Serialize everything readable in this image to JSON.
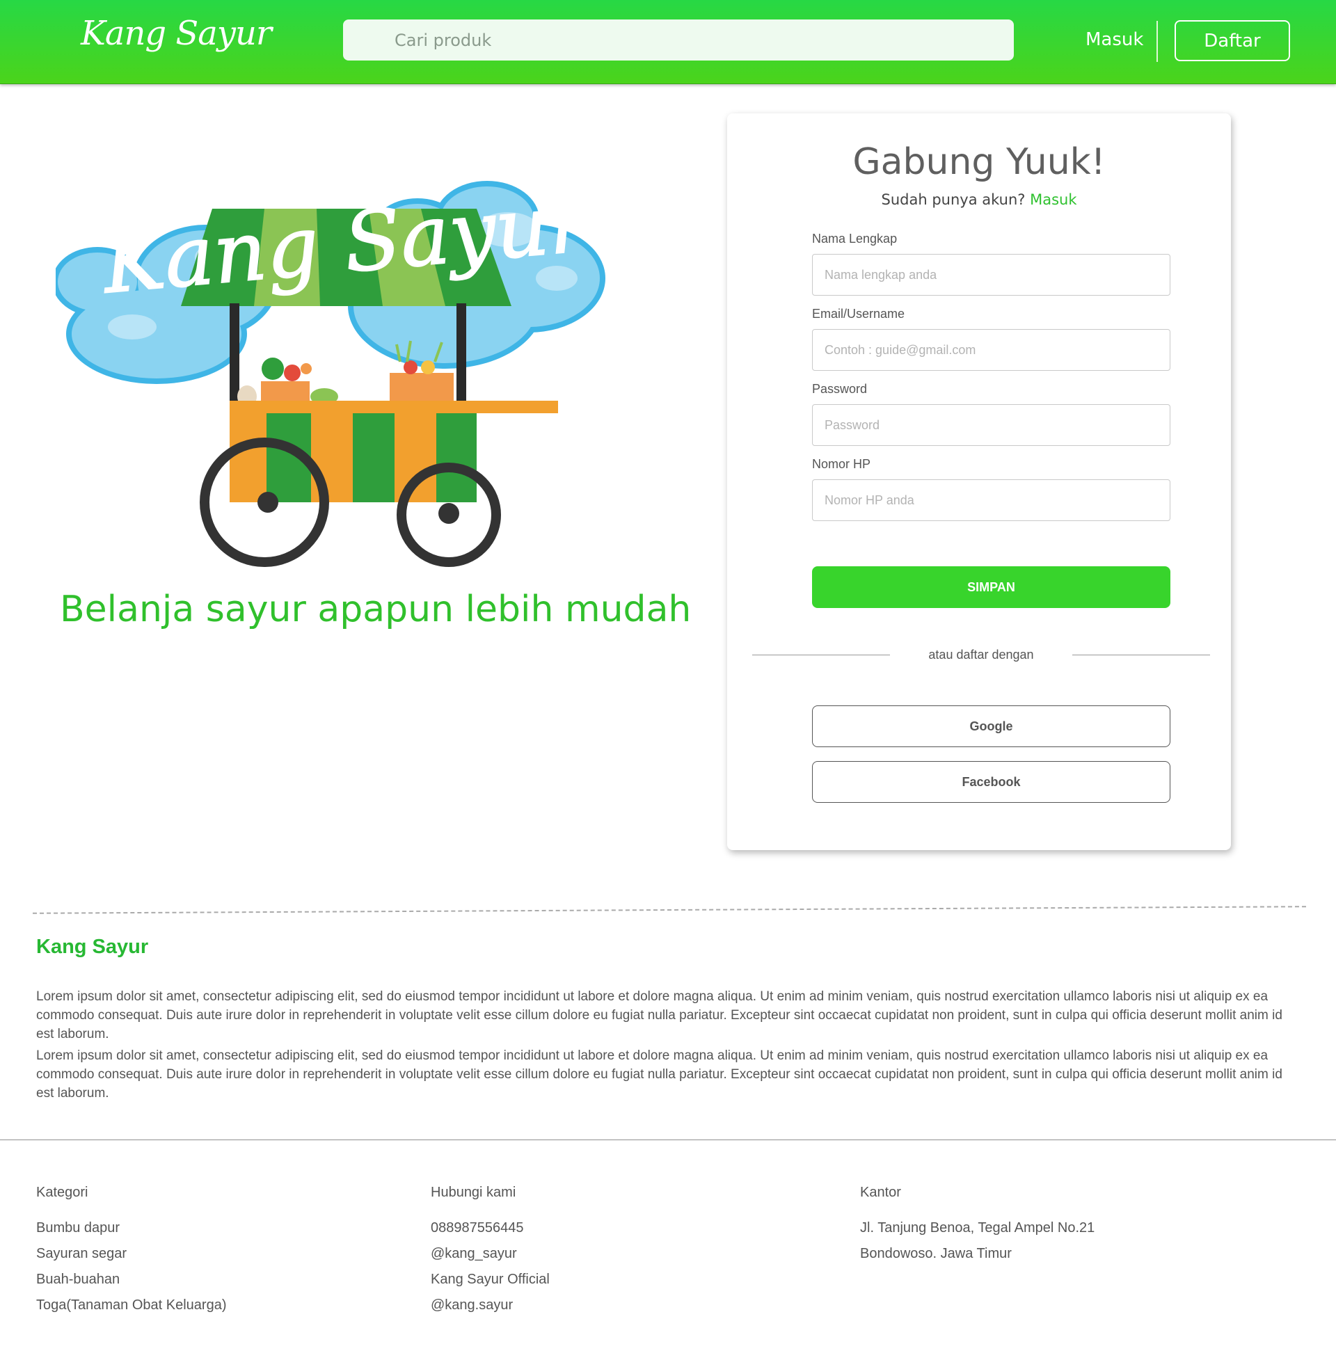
{
  "header": {
    "brand": "Kang Sayur",
    "search_placeholder": "Cari produk",
    "login_label": "Masuk",
    "register_label": "Daftar"
  },
  "hero": {
    "logo_text": "Kang Sayur",
    "tagline": "Belanja sayur apapun lebih mudah"
  },
  "form": {
    "title": "Gabung Yuuk!",
    "subtitle": "Sudah punya akun?",
    "subtitle_link": "Masuk",
    "fields": [
      {
        "label": "Nama Lengkap",
        "placeholder": "Nama lengkap anda",
        "value": ""
      },
      {
        "label": "Email/Username",
        "placeholder": "Contoh : guide@gmail.com",
        "value": ""
      },
      {
        "label": "Password",
        "placeholder": "Password",
        "value": ""
      },
      {
        "label": "Nomor HP",
        "placeholder": "Nomor HP anda",
        "value": ""
      }
    ],
    "submit_label": "SIMPAN",
    "divider_text": "atau daftar dengan",
    "social": [
      "Google",
      "Facebook"
    ]
  },
  "about": {
    "title": "Kang Sayur",
    "paragraphs": [
      "Lorem ipsum dolor sit amet, consectetur adipiscing elit, sed do eiusmod tempor incididunt ut labore et dolore magna aliqua. Ut enim ad minim veniam, quis nostrud exercitation ullamco laboris nisi ut aliquip ex ea commodo consequat. Duis aute irure dolor in reprehenderit in voluptate velit esse cillum dolore eu fugiat nulla pariatur. Excepteur sint occaecat cupidatat non proident, sunt in culpa qui officia deserunt mollit anim id est laborum.",
      "Lorem ipsum dolor sit amet, consectetur adipiscing elit, sed do eiusmod tempor incididunt ut labore et dolore magna aliqua. Ut enim ad minim veniam, quis nostrud exercitation ullamco laboris nisi ut aliquip ex ea commodo consequat. Duis aute irure dolor in reprehenderit in voluptate velit esse cillum dolore eu fugiat nulla pariatur. Excepteur sint occaecat cupidatat non proident, sunt in culpa qui officia deserunt mollit anim id est laborum."
    ]
  },
  "footer": {
    "kategori": {
      "title": "Kategori",
      "items": [
        "Bumbu dapur",
        "Sayuran segar",
        "Buah-buahan",
        "Toga(Tanaman Obat Keluarga)"
      ]
    },
    "hubungi": {
      "title": "Hubungi kami",
      "items": [
        "088987556445",
        "@kang_sayur",
        "Kang Sayur Official",
        "@kang.sayur"
      ]
    },
    "kantor": {
      "title": "Kantor",
      "items": [
        "Jl. Tanjung Benoa, Tegal Ampel No.21",
        "Bondowoso. Jawa Timur"
      ]
    }
  },
  "colors": {
    "brand_green": "#38d42c",
    "header_top": "#27d845",
    "header_bottom": "#4bd41b",
    "accent_text": "#30c02c"
  }
}
